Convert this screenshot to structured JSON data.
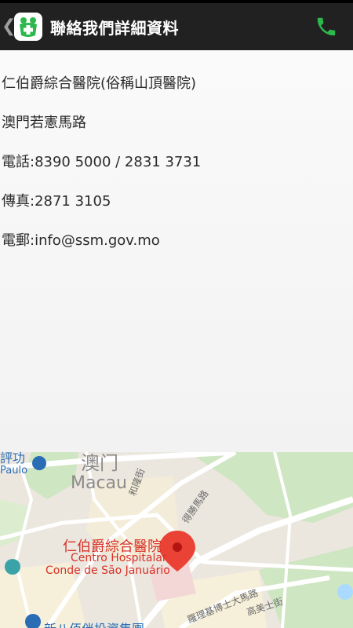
{
  "header": {
    "title": "聯絡我們詳細資料",
    "back_icon": "chevron-left-icon",
    "logo_icon": "medical-cross-icon",
    "phone_icon": "phone-icon",
    "accent_color": "#2db84d"
  },
  "details": {
    "name": "仁伯爵綜合醫院(俗稱山頂醫院)",
    "address": "澳門若憲馬路",
    "phone": "電話:8390 5000 / 2831 3731",
    "fax": "傳真:2871 3105",
    "email": "電郵:info@ssm.gov.mo"
  },
  "map": {
    "city_zh": "澳门",
    "city_en": "Macau",
    "place_top": "評功",
    "place_top_sub": "Paulo",
    "hospital_zh": "仁伯爵綜合醫院",
    "hospital_pt_line1": "Centro Hospitalar",
    "hospital_pt_line2": "Conde de São Januário",
    "street_1": "和隆街",
    "street_2": "得勝馬路",
    "street_3": "羅理基博士大馬路",
    "street_4": "高美士街",
    "bottom_place": "新八佰伴投資集團"
  }
}
